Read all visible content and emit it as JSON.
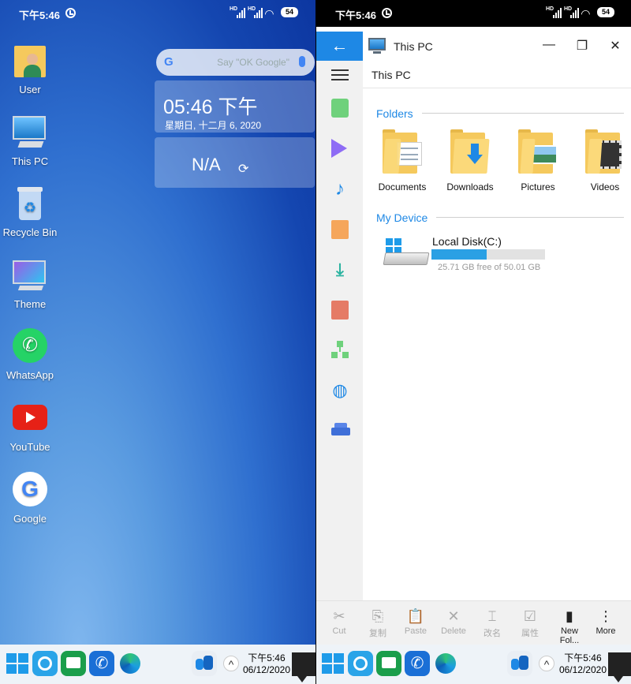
{
  "status": {
    "time": "下午5:46",
    "battery": "54"
  },
  "desktop": {
    "icons": [
      {
        "label": "User"
      },
      {
        "label": "This PC"
      },
      {
        "label": "Recycle Bin"
      },
      {
        "label": "Theme"
      },
      {
        "label": "WhatsApp"
      },
      {
        "label": "YouTube"
      },
      {
        "label": "Google"
      }
    ],
    "search": {
      "placeholder": "Say \"OK Google\"",
      "logo": "G"
    },
    "clock_widget": {
      "time": "05:46 下午",
      "date": "星期日, 十二月 6, 2020"
    },
    "weather_widget": {
      "value": "N/A",
      "refresh_icon": "refresh-icon"
    }
  },
  "taskbar": {
    "time": "下午5:46",
    "date": "06/12/2020",
    "up_glyph": "^"
  },
  "explorer": {
    "window_title": "This PC",
    "breadcrumb": "This PC",
    "back_glyph": "←",
    "window_controls": {
      "minimize": "—",
      "restore": "❐",
      "close": "✕"
    },
    "sections": {
      "folders": "Folders",
      "device": "My Device"
    },
    "folders": [
      {
        "label": "Documents",
        "icon": "documents-folder-icon"
      },
      {
        "label": "Downloads",
        "icon": "downloads-folder-icon"
      },
      {
        "label": "Pictures",
        "icon": "pictures-folder-icon"
      },
      {
        "label": "Videos",
        "icon": "videos-folder-icon"
      }
    ],
    "disk": {
      "name": "Local Disk(C:)",
      "free_text": "25.71 GB free of 50.01 GB",
      "used_fraction": 0.486
    },
    "actions": [
      {
        "label": "Cut",
        "glyph": "✂",
        "enabled": false
      },
      {
        "label": "复制",
        "glyph": "⎘",
        "enabled": false
      },
      {
        "label": "Paste",
        "glyph": "📋",
        "enabled": false
      },
      {
        "label": "Delete",
        "glyph": "✕",
        "enabled": false
      },
      {
        "label": "改名",
        "glyph": "⌶",
        "enabled": false
      },
      {
        "label": "属性",
        "glyph": "☑",
        "enabled": false
      },
      {
        "label": "New Fol...",
        "glyph": "▮",
        "enabled": true
      },
      {
        "label": "More",
        "glyph": "⋮",
        "enabled": true
      }
    ]
  },
  "colors": {
    "accent": "#1e88e5",
    "folder": "#f5c95d",
    "sidebar_music": "#1e88e5",
    "sidebar_video": "#8e6cf5",
    "sidebar_image": "#6fd17c",
    "sidebar_doc": "#f5a65b",
    "sidebar_download": "#2bb3a0"
  }
}
